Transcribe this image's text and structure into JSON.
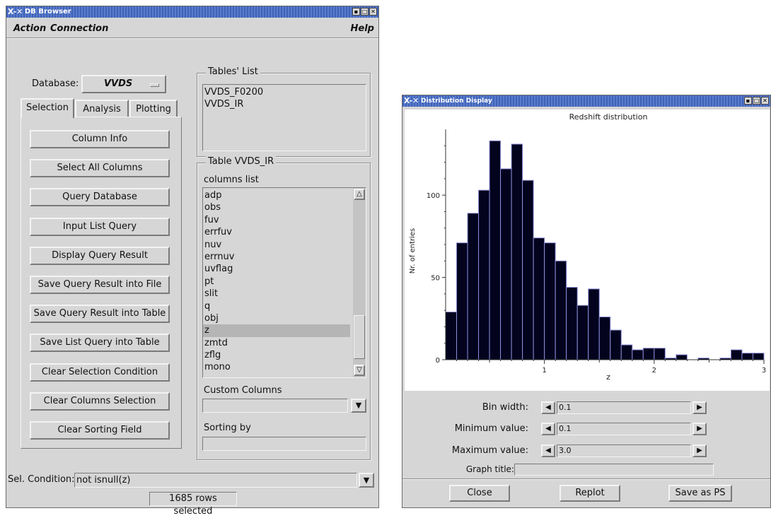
{
  "db_browser": {
    "title": "DB Browser",
    "menu": {
      "action": "Action",
      "connection": "Connection",
      "help": "Help"
    },
    "database_label": "Database:",
    "database_value": "VVDS",
    "tabs": [
      "Selection",
      "Analysis",
      "Plotting"
    ],
    "buttons": [
      "Column Info",
      "Select All Columns",
      "Query Database",
      "Input List Query",
      "Display Query Result",
      "Save Query Result into File",
      "Save Query Result into Table",
      "Save List Query into Table",
      "Clear Selection Condition",
      "Clear Columns Selection",
      "Clear Sorting Field"
    ],
    "tables_list": {
      "label": "Tables' List",
      "items": [
        "VVDS_F0200",
        "VVDS_IR"
      ]
    },
    "table_panel": {
      "label": "Table VVDS_IR",
      "columns_label": "columns list",
      "columns": [
        "adp",
        "obs",
        "fuv",
        "errfuv",
        "nuv",
        "errnuv",
        "uvflag",
        "pt",
        "slit",
        "q",
        "obj",
        "z",
        "zmtd",
        "zflg",
        "mono"
      ],
      "selected_column": "z",
      "custom_columns_label": "Custom Columns",
      "custom_columns_value": "",
      "sorting_label": "Sorting by",
      "sorting_value": ""
    },
    "sel_condition_label": "Sel. Condition:",
    "sel_condition_value": "not isnull(z)",
    "status": "1685 rows selected"
  },
  "distribution": {
    "title": "Distribution Display",
    "controls": {
      "bin_width_label": "Bin width:",
      "bin_width_value": "0.1",
      "min_label": "Minimum value:",
      "min_value": "0.1",
      "max_label": "Maximum value:",
      "max_value": "3.0",
      "graph_title_label": "Graph title:",
      "graph_title_value": ""
    },
    "buttons": {
      "close": "Close",
      "replot": "Replot",
      "save": "Save as PS"
    }
  },
  "chart_data": {
    "type": "bar",
    "title": "Redshift distribution",
    "xlabel": "z",
    "ylabel": "Nr. of entries",
    "bin_width": 0.1,
    "bin_starts": [
      0.1,
      0.2,
      0.3,
      0.4,
      0.5,
      0.6,
      0.7,
      0.8,
      0.9,
      1.0,
      1.1,
      1.2,
      1.3,
      1.4,
      1.5,
      1.6,
      1.7,
      1.8,
      1.9,
      2.0,
      2.1,
      2.2,
      2.3,
      2.4,
      2.5,
      2.6,
      2.7,
      2.8,
      2.9
    ],
    "values": [
      29,
      71,
      89,
      103,
      133,
      116,
      131,
      109,
      74,
      71,
      60,
      44,
      33,
      43,
      26,
      18,
      9,
      6,
      7,
      7,
      1,
      3,
      0,
      1,
      0,
      1,
      6,
      4,
      4
    ],
    "xlim": [
      0.1,
      3.0
    ],
    "ylim": [
      0,
      140
    ],
    "xticks": [
      "1",
      "2",
      "3"
    ],
    "yticks": [
      "0",
      "50",
      "100"
    ],
    "colors": {
      "bar": "#03031e",
      "bar_edge": "#8c8cd8"
    }
  }
}
